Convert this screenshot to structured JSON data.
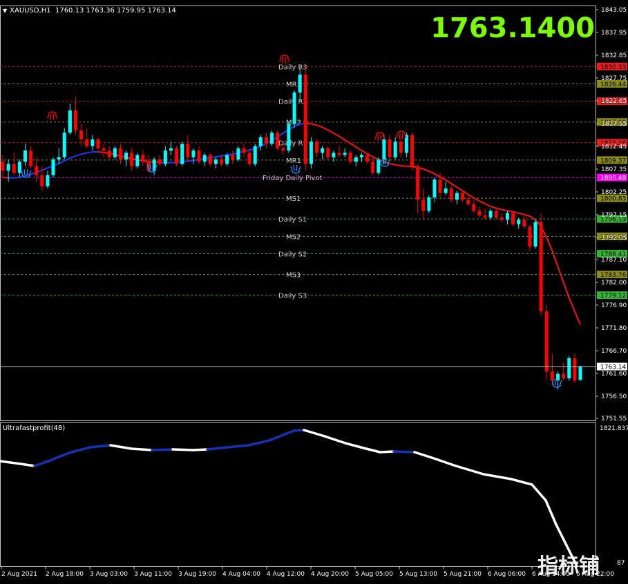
{
  "header": {
    "symbol": "XAUUSD,H1",
    "ohlc": "1760.13 1763.36 1759.95 1763.14"
  },
  "big_price": "1763.1400",
  "indicator": {
    "title": "Ultrafastprofit(48)",
    "scale_top": "1821.837",
    "scale_bottom": "87"
  },
  "watermark": "指标铺",
  "price_axis": [
    "1843.05",
    "1837.95",
    "1832.85",
    "1827.75",
    "1822.65",
    "1817.55",
    "1812.45",
    "1807.35",
    "1802.25",
    "1797.15",
    "1792.05",
    "1787.10",
    "1782.00",
    "1776.90",
    "1771.80",
    "1766.70",
    "1761.60",
    "1756.50",
    "1751.55"
  ],
  "time_axis": [
    "2 Aug 2021",
    "2 Aug 18:00",
    "3 Aug 03:00",
    "3 Aug 11:00",
    "3 Aug 19:00",
    "4 Aug 04:00",
    "4 Aug 12:00",
    "4 Aug 20:00",
    "5 Aug 05:00",
    "5 Aug 13:00",
    "5 Aug 21:00",
    "6 Aug 06:00",
    "6 Aug 14:00",
    "6 Aug 22:00"
  ],
  "current_price_tag": "1763.14",
  "levels": [
    {
      "label": "Daily R3",
      "price": 1830.33,
      "tag": "1830.33",
      "kind": "daily-r"
    },
    {
      "label": "MR3",
      "price": 1826.44,
      "tag": "1826.44",
      "kind": "mid"
    },
    {
      "label": "Daily R2",
      "price": 1822.55,
      "tag": "1822.55",
      "kind": "daily-r"
    },
    {
      "label": "MR2",
      "price": 1817.9,
      "tag": "1817.90",
      "kind": "mid"
    },
    {
      "label": "Daily R1",
      "price": 1813.26,
      "tag": "1813.26",
      "kind": "daily-r"
    },
    {
      "label": "MR1",
      "price": 1809.37,
      "tag": "1809.37",
      "kind": "mid"
    },
    {
      "label": "Friday  Daily Pivot",
      "price": 1805.48,
      "tag": "1805.48",
      "kind": "pivot"
    },
    {
      "label": "MS1",
      "price": 1800.83,
      "tag": "1800.83",
      "kind": "mid"
    },
    {
      "label": "Daily S1",
      "price": 1796.19,
      "tag": "1796.19",
      "kind": "daily-s"
    },
    {
      "label": "MS2",
      "price": 1792.3,
      "tag": "1792.30",
      "kind": "mid"
    },
    {
      "label": "Daily S2",
      "price": 1788.41,
      "tag": "1788.41",
      "kind": "daily-s"
    },
    {
      "label": "MS3",
      "price": 1783.76,
      "tag": "1783.76",
      "kind": "mid"
    },
    {
      "label": "Daily S3",
      "price": 1779.12,
      "tag": "1779.12",
      "kind": "daily-s"
    }
  ],
  "colors": {
    "bull": "#00FFFF",
    "bear": "#FF0000",
    "ma_up": "#1E3AFF",
    "ma_down": "#FF1010",
    "daily_r_line": "#C81E1E",
    "mid_line": "#8C8C28",
    "daily_s_line": "#32A032",
    "pivot_line": "#FF00FF",
    "tag_r": "#E61E1E",
    "tag_mid": "#8C8C14",
    "tag_s": "#32B432",
    "tag_pivot": "#FF00FF",
    "price_text": "#7CFC00"
  },
  "chart_data": {
    "type": "candlestick",
    "symbol": "XAUUSD,H1",
    "ylim": [
      1751.55,
      1843.05
    ],
    "candles": [
      [
        1809.0,
        1810.5,
        1805.5,
        1807.0
      ],
      [
        1807.0,
        1809.5,
        1804.5,
        1808.5
      ],
      [
        1808.5,
        1811.0,
        1806.0,
        1806.5
      ],
      [
        1806.5,
        1809.5,
        1805.5,
        1809.0
      ],
      [
        1809.0,
        1813.0,
        1808.0,
        1811.5
      ],
      [
        1811.5,
        1812.5,
        1807.5,
        1808.0
      ],
      [
        1808.0,
        1810.0,
        1804.5,
        1806.0
      ],
      [
        1806.0,
        1808.0,
        1802.5,
        1803.5
      ],
      [
        1803.5,
        1807.0,
        1803.0,
        1806.0
      ],
      [
        1806.0,
        1810.0,
        1805.5,
        1809.5
      ],
      [
        1809.5,
        1812.0,
        1808.5,
        1810.0
      ],
      [
        1810.0,
        1816.5,
        1809.5,
        1815.5
      ],
      [
        1815.5,
        1822.0,
        1815.0,
        1820.5
      ],
      [
        1820.5,
        1823.5,
        1815.0,
        1816.0
      ],
      [
        1816.0,
        1817.5,
        1812.5,
        1814.0
      ],
      [
        1814.0,
        1816.5,
        1812.0,
        1812.5
      ],
      [
        1812.5,
        1815.0,
        1811.5,
        1814.0
      ],
      [
        1814.0,
        1814.5,
        1811.5,
        1812.0
      ],
      [
        1812.0,
        1813.0,
        1810.0,
        1811.5
      ],
      [
        1811.5,
        1812.5,
        1809.5,
        1810.0
      ],
      [
        1810.0,
        1812.5,
        1809.5,
        1812.0
      ],
      [
        1812.0,
        1813.0,
        1808.5,
        1809.5
      ],
      [
        1809.5,
        1811.5,
        1808.0,
        1811.0
      ],
      [
        1811.0,
        1812.0,
        1807.0,
        1808.0
      ],
      [
        1808.0,
        1811.0,
        1807.5,
        1810.5
      ],
      [
        1810.5,
        1811.5,
        1808.0,
        1809.0
      ],
      [
        1809.0,
        1810.5,
        1806.5,
        1807.0
      ],
      [
        1807.0,
        1810.0,
        1806.0,
        1809.5
      ],
      [
        1809.5,
        1810.5,
        1808.0,
        1808.5
      ],
      [
        1808.5,
        1812.5,
        1808.0,
        1811.5
      ],
      [
        1811.5,
        1813.5,
        1810.5,
        1812.0
      ],
      [
        1812.0,
        1812.5,
        1808.0,
        1808.5
      ],
      [
        1808.5,
        1813.5,
        1808.0,
        1813.0
      ],
      [
        1813.0,
        1815.0,
        1809.0,
        1810.0
      ],
      [
        1810.0,
        1812.0,
        1808.5,
        1811.5
      ],
      [
        1811.5,
        1812.5,
        1808.5,
        1809.0
      ],
      [
        1809.0,
        1811.0,
        1808.0,
        1810.5
      ],
      [
        1810.5,
        1811.0,
        1808.0,
        1808.5
      ],
      [
        1808.5,
        1810.0,
        1807.5,
        1809.5
      ],
      [
        1809.5,
        1810.5,
        1808.0,
        1808.5
      ],
      [
        1808.5,
        1811.0,
        1808.0,
        1810.5
      ],
      [
        1810.5,
        1811.5,
        1808.5,
        1809.5
      ],
      [
        1809.5,
        1812.5,
        1809.0,
        1812.0
      ],
      [
        1812.0,
        1813.0,
        1810.0,
        1811.0
      ],
      [
        1811.0,
        1812.0,
        1808.0,
        1808.5
      ],
      [
        1808.5,
        1813.0,
        1808.0,
        1812.5
      ],
      [
        1812.5,
        1815.0,
        1811.5,
        1814.5
      ],
      [
        1814.5,
        1815.5,
        1812.0,
        1813.0
      ],
      [
        1813.0,
        1816.0,
        1812.5,
        1815.5
      ],
      [
        1815.5,
        1816.0,
        1811.5,
        1812.0
      ],
      [
        1812.0,
        1813.5,
        1810.5,
        1811.5
      ],
      [
        1811.5,
        1818.0,
        1811.0,
        1817.5
      ],
      [
        1817.5,
        1825.0,
        1816.5,
        1824.5
      ],
      [
        1824.5,
        1830.0,
        1822.5,
        1828.5
      ],
      [
        1828.5,
        1830.5,
        1807.0,
        1808.5
      ],
      [
        1808.5,
        1814.5,
        1807.5,
        1813.5
      ],
      [
        1813.5,
        1814.0,
        1810.0,
        1811.0
      ],
      [
        1811.0,
        1812.5,
        1809.5,
        1812.0
      ],
      [
        1812.0,
        1812.5,
        1809.5,
        1810.0
      ],
      [
        1810.0,
        1811.5,
        1809.0,
        1811.0
      ],
      [
        1811.0,
        1812.5,
        1810.0,
        1810.5
      ],
      [
        1810.5,
        1812.0,
        1810.0,
        1811.0
      ],
      [
        1811.0,
        1811.5,
        1808.5,
        1809.0
      ],
      [
        1809.0,
        1810.5,
        1808.0,
        1810.0
      ],
      [
        1810.0,
        1811.0,
        1809.0,
        1810.5
      ],
      [
        1810.5,
        1811.0,
        1808.5,
        1809.0
      ],
      [
        1809.0,
        1810.0,
        1806.0,
        1806.5
      ],
      [
        1806.5,
        1810.0,
        1806.0,
        1809.5
      ],
      [
        1809.5,
        1815.0,
        1808.5,
        1814.0
      ],
      [
        1814.0,
        1815.0,
        1809.5,
        1810.0
      ],
      [
        1810.0,
        1814.5,
        1809.5,
        1813.5
      ],
      [
        1813.5,
        1814.5,
        1810.0,
        1811.0
      ],
      [
        1811.0,
        1815.5,
        1810.0,
        1815.0
      ],
      [
        1815.0,
        1815.5,
        1807.0,
        1808.0
      ],
      [
        1808.0,
        1808.5,
        1797.5,
        1800.5
      ],
      [
        1800.5,
        1803.0,
        1796.0,
        1798.0
      ],
      [
        1798.0,
        1801.5,
        1797.5,
        1801.0
      ],
      [
        1801.0,
        1805.5,
        1800.0,
        1805.0
      ],
      [
        1805.0,
        1806.5,
        1801.0,
        1802.0
      ],
      [
        1802.0,
        1804.5,
        1801.5,
        1803.0
      ],
      [
        1803.0,
        1803.5,
        1800.0,
        1800.5
      ],
      [
        1800.5,
        1802.5,
        1799.5,
        1802.0
      ],
      [
        1802.0,
        1802.5,
        1800.0,
        1800.5
      ],
      [
        1800.5,
        1801.5,
        1799.0,
        1799.5
      ],
      [
        1799.5,
        1800.5,
        1797.5,
        1798.0
      ],
      [
        1798.0,
        1799.0,
        1796.5,
        1797.0
      ],
      [
        1797.0,
        1798.5,
        1796.0,
        1796.5
      ],
      [
        1796.5,
        1798.5,
        1796.0,
        1798.0
      ],
      [
        1798.0,
        1798.5,
        1796.0,
        1796.5
      ],
      [
        1796.5,
        1797.5,
        1795.5,
        1796.0
      ],
      [
        1796.0,
        1798.0,
        1795.0,
        1797.5
      ],
      [
        1797.5,
        1798.0,
        1794.5,
        1795.0
      ],
      [
        1795.0,
        1796.5,
        1794.0,
        1796.0
      ],
      [
        1796.0,
        1797.0,
        1794.0,
        1794.5
      ],
      [
        1794.5,
        1795.0,
        1789.0,
        1790.0
      ],
      [
        1790.0,
        1796.0,
        1789.5,
        1795.5
      ],
      [
        1795.5,
        1797.5,
        1774.5,
        1775.5
      ],
      [
        1775.5,
        1777.0,
        1760.0,
        1762.0
      ],
      [
        1762.0,
        1766.0,
        1759.0,
        1760.0
      ],
      [
        1760.0,
        1762.0,
        1758.0,
        1761.5
      ],
      [
        1761.5,
        1764.0,
        1760.0,
        1760.5
      ],
      [
        1760.5,
        1765.5,
        1760.0,
        1765.0
      ],
      [
        1765.0,
        1766.0,
        1759.5,
        1760.0
      ],
      [
        1760.13,
        1763.36,
        1759.95,
        1763.14
      ]
    ],
    "ma": [
      1805.5,
      1805.4,
      1805.4,
      1805.5,
      1805.8,
      1806.2,
      1806.6,
      1807.1,
      1807.6,
      1808.1,
      1808.6,
      1809.2,
      1809.8,
      1810.3,
      1810.7,
      1811.0,
      1811.2,
      1811.2,
      1811.1,
      1810.9,
      1810.6,
      1810.3,
      1810.0,
      1809.7,
      1809.4,
      1809.2,
      1809.0,
      1808.9,
      1808.8,
      1808.8,
      1808.8,
      1808.9,
      1809.0,
      1809.1,
      1809.3,
      1809.5,
      1809.7,
      1809.9,
      1810.1,
      1810.3,
      1810.5,
      1810.7,
      1811.0,
      1811.3,
      1811.6,
      1812.0,
      1812.5,
      1813.1,
      1813.8,
      1814.6,
      1815.4,
      1816.2,
      1816.9,
      1817.4,
      1817.6,
      1817.5,
      1817.2,
      1816.7,
      1816.1,
      1815.4,
      1814.7,
      1813.9,
      1813.1,
      1812.3,
      1811.5,
      1810.8,
      1810.1,
      1809.5,
      1809.0,
      1808.6,
      1808.3,
      1808.1,
      1808.0,
      1807.9,
      1807.7,
      1807.4,
      1806.9,
      1806.3,
      1805.6,
      1804.9,
      1804.1,
      1803.3,
      1802.5,
      1801.7,
      1800.9,
      1800.2,
      1799.6,
      1799.0,
      1798.6,
      1798.3,
      1798.0,
      1797.8,
      1797.5,
      1797.2,
      1796.8,
      1796.0,
      1794.5,
      1792.0,
      1789.0,
      1785.5,
      1782.0,
      1778.5,
      1775.5,
      1772.5,
      1769.5
    ]
  }
}
